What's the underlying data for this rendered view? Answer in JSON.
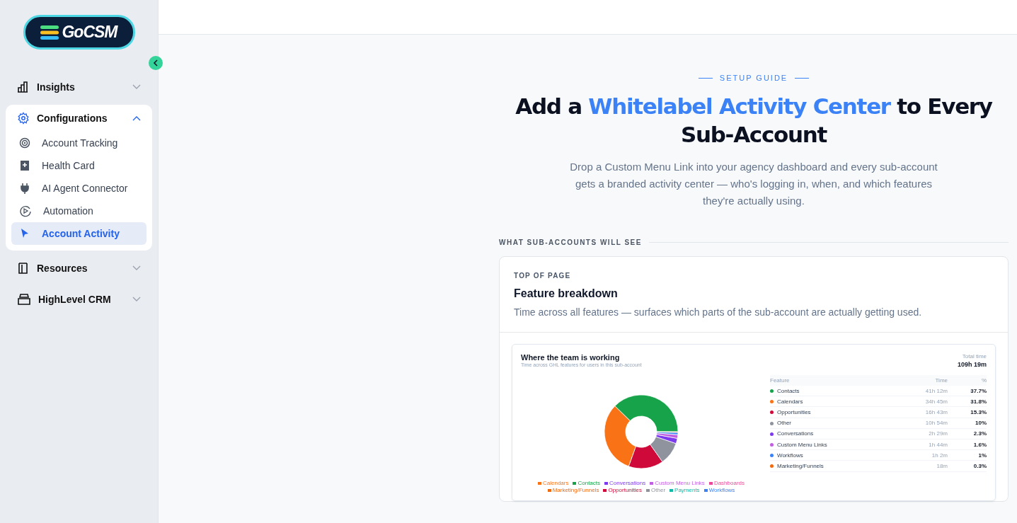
{
  "sidebar": {
    "logo_text": "GoCSM",
    "items": [
      {
        "label": "Insights",
        "expanded": false
      },
      {
        "label": "Configurations",
        "expanded": true,
        "children": [
          {
            "label": "Account Tracking",
            "selected": false
          },
          {
            "label": "Health Card",
            "selected": false
          },
          {
            "label": "AI Agent Connector",
            "selected": false
          },
          {
            "label": "Automation",
            "selected": false
          },
          {
            "label": "Account Activity",
            "selected": true
          }
        ]
      },
      {
        "label": "Resources",
        "expanded": false
      },
      {
        "label": "HighLevel CRM",
        "expanded": false
      }
    ]
  },
  "hero": {
    "eyebrow": "SETUP GUIDE",
    "title_before": "Add a ",
    "title_highlight": "Whitelabel Activity Center",
    "title_after": " to Every Sub-Account",
    "subtitle": "Drop a Custom Menu Link into your agency dashboard and every sub-account gets a branded activity center — who's logging in, when, and which features they're actually using."
  },
  "section_label": "WHAT SUB-ACCOUNTS WILL SEE",
  "card": {
    "eyebrow": "TOP OF PAGE",
    "title": "Feature breakdown",
    "description": "Time across all features — surfaces which parts of the sub-account are actually getting used.",
    "preview": {
      "title": "Where the team is working",
      "subtitle": "Time across GHL features for users in this sub-account",
      "total_label": "Total time",
      "total_value": "109h 19m",
      "chart_data": {
        "type": "donut",
        "legend": "bottom",
        "categories": [
          "Calendars",
          "Contacts",
          "Conversations",
          "Custom Menu Links",
          "Dashboards",
          "Marketing/Funnels",
          "Opportunities",
          "Other",
          "Payments",
          "Workflows"
        ],
        "values": [
          31.8,
          37.7,
          2.3,
          1.6,
          null,
          0.3,
          15.3,
          10,
          null,
          1
        ],
        "colors": [
          "#f97316",
          "#16a34a",
          "#7c3aed",
          "#c05fe0",
          "#ec4899",
          "#f26a0f",
          "#cf0a3a",
          "#8e939d",
          "#14b8a6",
          "#3b82f6"
        ]
      },
      "table": {
        "columns": [
          "Feature",
          "Time",
          "%"
        ],
        "rows": [
          {
            "feature": "Contacts",
            "color": "#16a34a",
            "time": "41h 12m",
            "percent": "37.7%"
          },
          {
            "feature": "Calendars",
            "color": "#f97316",
            "time": "34h 45m",
            "percent": "31.8%"
          },
          {
            "feature": "Opportunities",
            "color": "#cf0a3a",
            "time": "16h 43m",
            "percent": "15.3%"
          },
          {
            "feature": "Other",
            "color": "#8e939d",
            "time": "10h 54m",
            "percent": "10%"
          },
          {
            "feature": "Conversations",
            "color": "#7c3aed",
            "time": "2h 29m",
            "percent": "2.3%"
          },
          {
            "feature": "Custom Menu Links",
            "color": "#c05fe0",
            "time": "1h 44m",
            "percent": "1.6%"
          },
          {
            "feature": "Workflows",
            "color": "#3b82f6",
            "time": "1h 2m",
            "percent": "1%"
          },
          {
            "feature": "Marketing/Funnels",
            "color": "#f26a0f",
            "time": "18m",
            "percent": "0.3%"
          }
        ]
      }
    }
  }
}
